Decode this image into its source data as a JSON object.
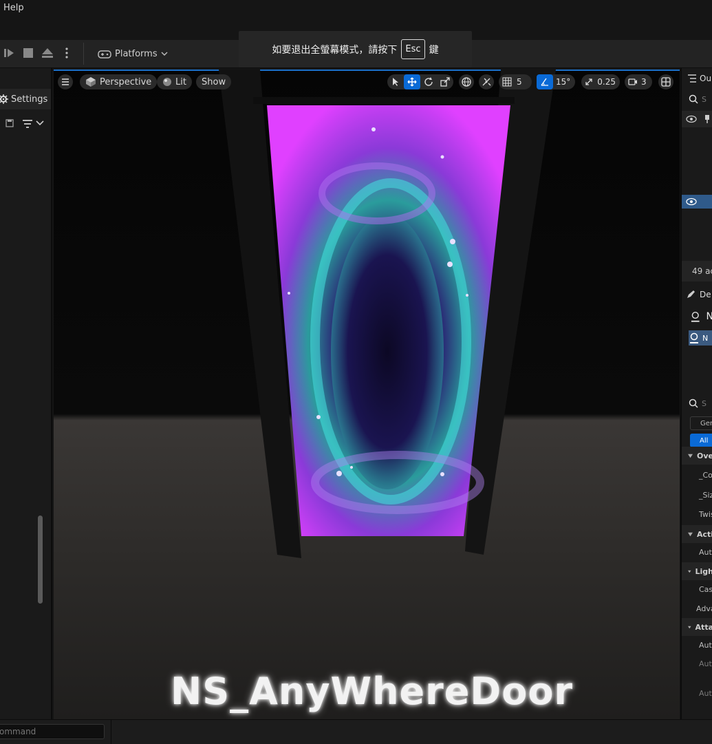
{
  "menu": {
    "help": "Help"
  },
  "toolbar": {
    "platforms_label": "Platforms"
  },
  "toast": {
    "text_before": "如要退出全螢幕模式，請按下",
    "key": "Esc",
    "text_after": "鍵"
  },
  "left_panel": {
    "settings_label": "Settings"
  },
  "viewport": {
    "perspective_label": "Perspective",
    "lit_label": "Lit",
    "show_label": "Show",
    "grid_snap": "5",
    "angle_snap": "15°",
    "scale_snap": "0.25",
    "camera_speed": "3",
    "actor_label": "NS_AnyWhereDoor"
  },
  "right_panel": {
    "outliner_tab": "Ou",
    "search_placeholder": "S",
    "actor_count": "49 ac",
    "details_tab": "De",
    "component_name_1": "N",
    "component_name_2": "N",
    "details_search_placeholder": "S",
    "filter_general": "Gen",
    "filter_all": "All",
    "sections": {
      "overrides": "Ove",
      "actions": "Acti",
      "lighting": "Ligh",
      "advanced": "Adva",
      "attachment": "Atta"
    },
    "props": {
      "color": "_Col",
      "size": "_Siz",
      "twist": "Twis",
      "auto1": "Auto",
      "cast": "Cast",
      "auto2": "Auto",
      "auto3": "Auto",
      "auto4": "Auto"
    }
  },
  "bottom": {
    "command_placeholder": "ommand"
  },
  "colors": {
    "accent": "#0a6ad6",
    "portal_magenta": "#e040ff",
    "portal_cyan": "#40e0e0"
  }
}
